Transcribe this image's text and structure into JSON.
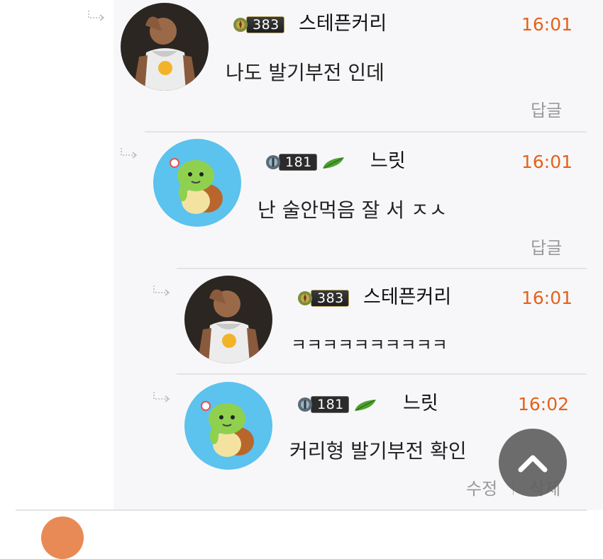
{
  "comments": [
    {
      "level_badge": "383",
      "author": "스테픈커리",
      "time": "16:01",
      "text": "나도 발기부전 인데",
      "actions": [
        "답글"
      ]
    },
    {
      "level_badge": "181",
      "author": "느릿",
      "time": "16:01",
      "text": "난 술안먹음 잘 서 ㅈㅅ",
      "actions": [
        "답글"
      ]
    },
    {
      "level_badge": "383",
      "author": "스테픈커리",
      "time": "16:01",
      "text": "ㅋㅋㅋㅋㅋㅋㅋㅋㅋㅋ",
      "actions": []
    },
    {
      "level_badge": "181",
      "author": "느릿",
      "time": "16:02",
      "text": "커리형 발기부전 확인",
      "actions": [
        "수정",
        "삭제"
      ]
    }
  ],
  "icons": {
    "reply_arrow": "reply-arrow-icon",
    "scroll_top": "chevron-up-icon",
    "leaf": "leaf-icon"
  },
  "colors": {
    "time": "#e4621b",
    "action": "#999999",
    "thread_bg": "#f7f7f9",
    "top_button": "#5f5f5f"
  }
}
